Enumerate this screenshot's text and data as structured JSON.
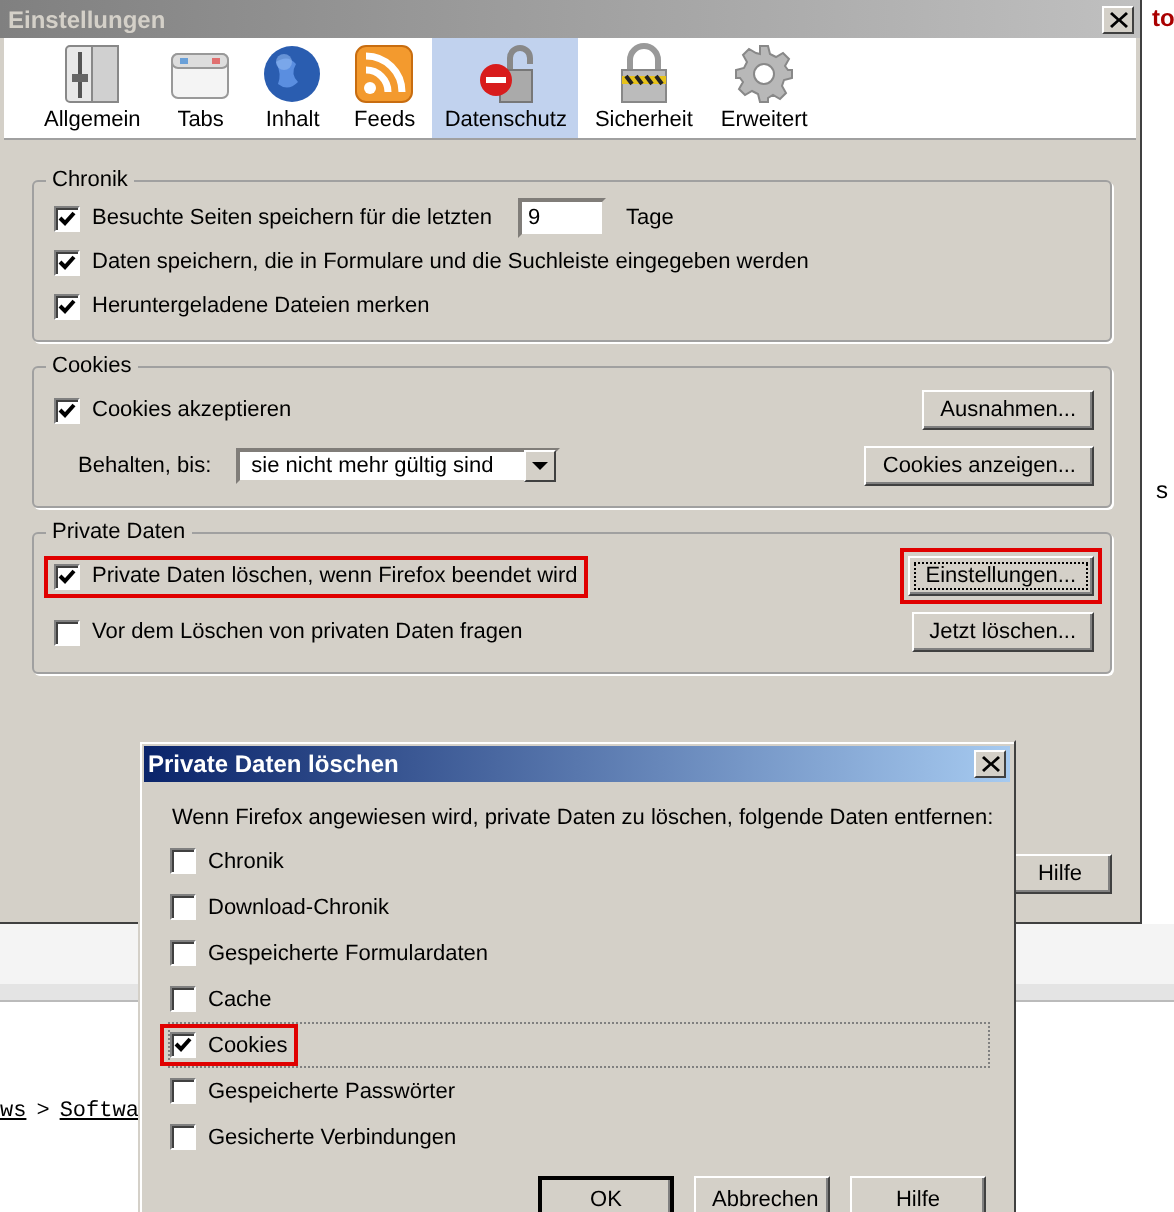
{
  "background_page": {
    "corner_text": "to",
    "side_text": "s",
    "breadcrumb": [
      "ws",
      ">",
      "Softwa"
    ]
  },
  "window": {
    "title": "Einstellungen",
    "help_button": "Hilfe"
  },
  "tabs": [
    {
      "label": "Allgemein",
      "selected": false
    },
    {
      "label": "Tabs",
      "selected": false
    },
    {
      "label": "Inhalt",
      "selected": false
    },
    {
      "label": "Feeds",
      "selected": false
    },
    {
      "label": "Datenschutz",
      "selected": true
    },
    {
      "label": "Sicherheit",
      "selected": false
    },
    {
      "label": "Erweitert",
      "selected": false
    }
  ],
  "sections": [
    {
      "title": "Chronik",
      "rows": [
        {
          "kind": "checkbox",
          "label": "Besuchte Seiten speichern für die letzten",
          "checked": true,
          "highlighted": false,
          "value": "9",
          "unit": "Tage"
        },
        {
          "kind": "checkbox",
          "label": "Daten speichern, die in Formulare und die Suchleiste eingegeben werden",
          "checked": true,
          "highlighted": false
        },
        {
          "kind": "checkbox",
          "label": "Heruntergeladene Dateien merken",
          "checked": true,
          "highlighted": false
        }
      ]
    },
    {
      "title": "Cookies",
      "rows": [
        {
          "kind": "checkbox",
          "label": "Cookies akzeptieren",
          "checked": true,
          "highlighted": false
        },
        {
          "kind": "select",
          "label": "Behalten, bis:",
          "value": "sie nicht mehr gültig sind"
        }
      ],
      "buttons": [
        {
          "label": "Ausnahmen...",
          "highlighted": false,
          "focused": false
        },
        {
          "label": "Cookies anzeigen...",
          "highlighted": false,
          "focused": false
        }
      ]
    },
    {
      "title": "Private Daten",
      "rows": [
        {
          "kind": "checkbox",
          "label": "Private Daten löschen, wenn Firefox beendet wird",
          "checked": true,
          "highlighted": true
        },
        {
          "kind": "checkbox",
          "label": "Vor dem Löschen von privaten Daten fragen",
          "checked": false,
          "highlighted": false
        }
      ],
      "buttons": [
        {
          "label": "Einstellungen...",
          "highlighted": true,
          "focused": true
        },
        {
          "label": "Jetzt löschen...",
          "highlighted": false,
          "focused": false
        }
      ]
    }
  ],
  "dialog": {
    "title": "Private Daten löschen",
    "intro": "Wenn Firefox angewiesen wird, private Daten zu löschen, folgende Daten entfernen:",
    "items": [
      {
        "label": "Chronik",
        "checked": false,
        "highlighted": false,
        "focused": false
      },
      {
        "label": "Download-Chronik",
        "checked": false,
        "highlighted": false,
        "focused": false
      },
      {
        "label": "Gespeicherte Formulardaten",
        "checked": false,
        "highlighted": false,
        "focused": false
      },
      {
        "label": "Cache",
        "checked": false,
        "highlighted": false,
        "focused": false
      },
      {
        "label": "Cookies",
        "checked": true,
        "highlighted": true,
        "focused": true
      },
      {
        "label": "Gespeicherte Passwörter",
        "checked": false,
        "highlighted": false,
        "focused": false
      },
      {
        "label": "Gesicherte Verbindungen",
        "checked": false,
        "highlighted": false,
        "focused": false
      }
    ],
    "buttons": [
      {
        "label": "OK",
        "default": true
      },
      {
        "label": "Abbrechen",
        "default": false
      },
      {
        "label": "Hilfe",
        "default": false
      }
    ]
  }
}
